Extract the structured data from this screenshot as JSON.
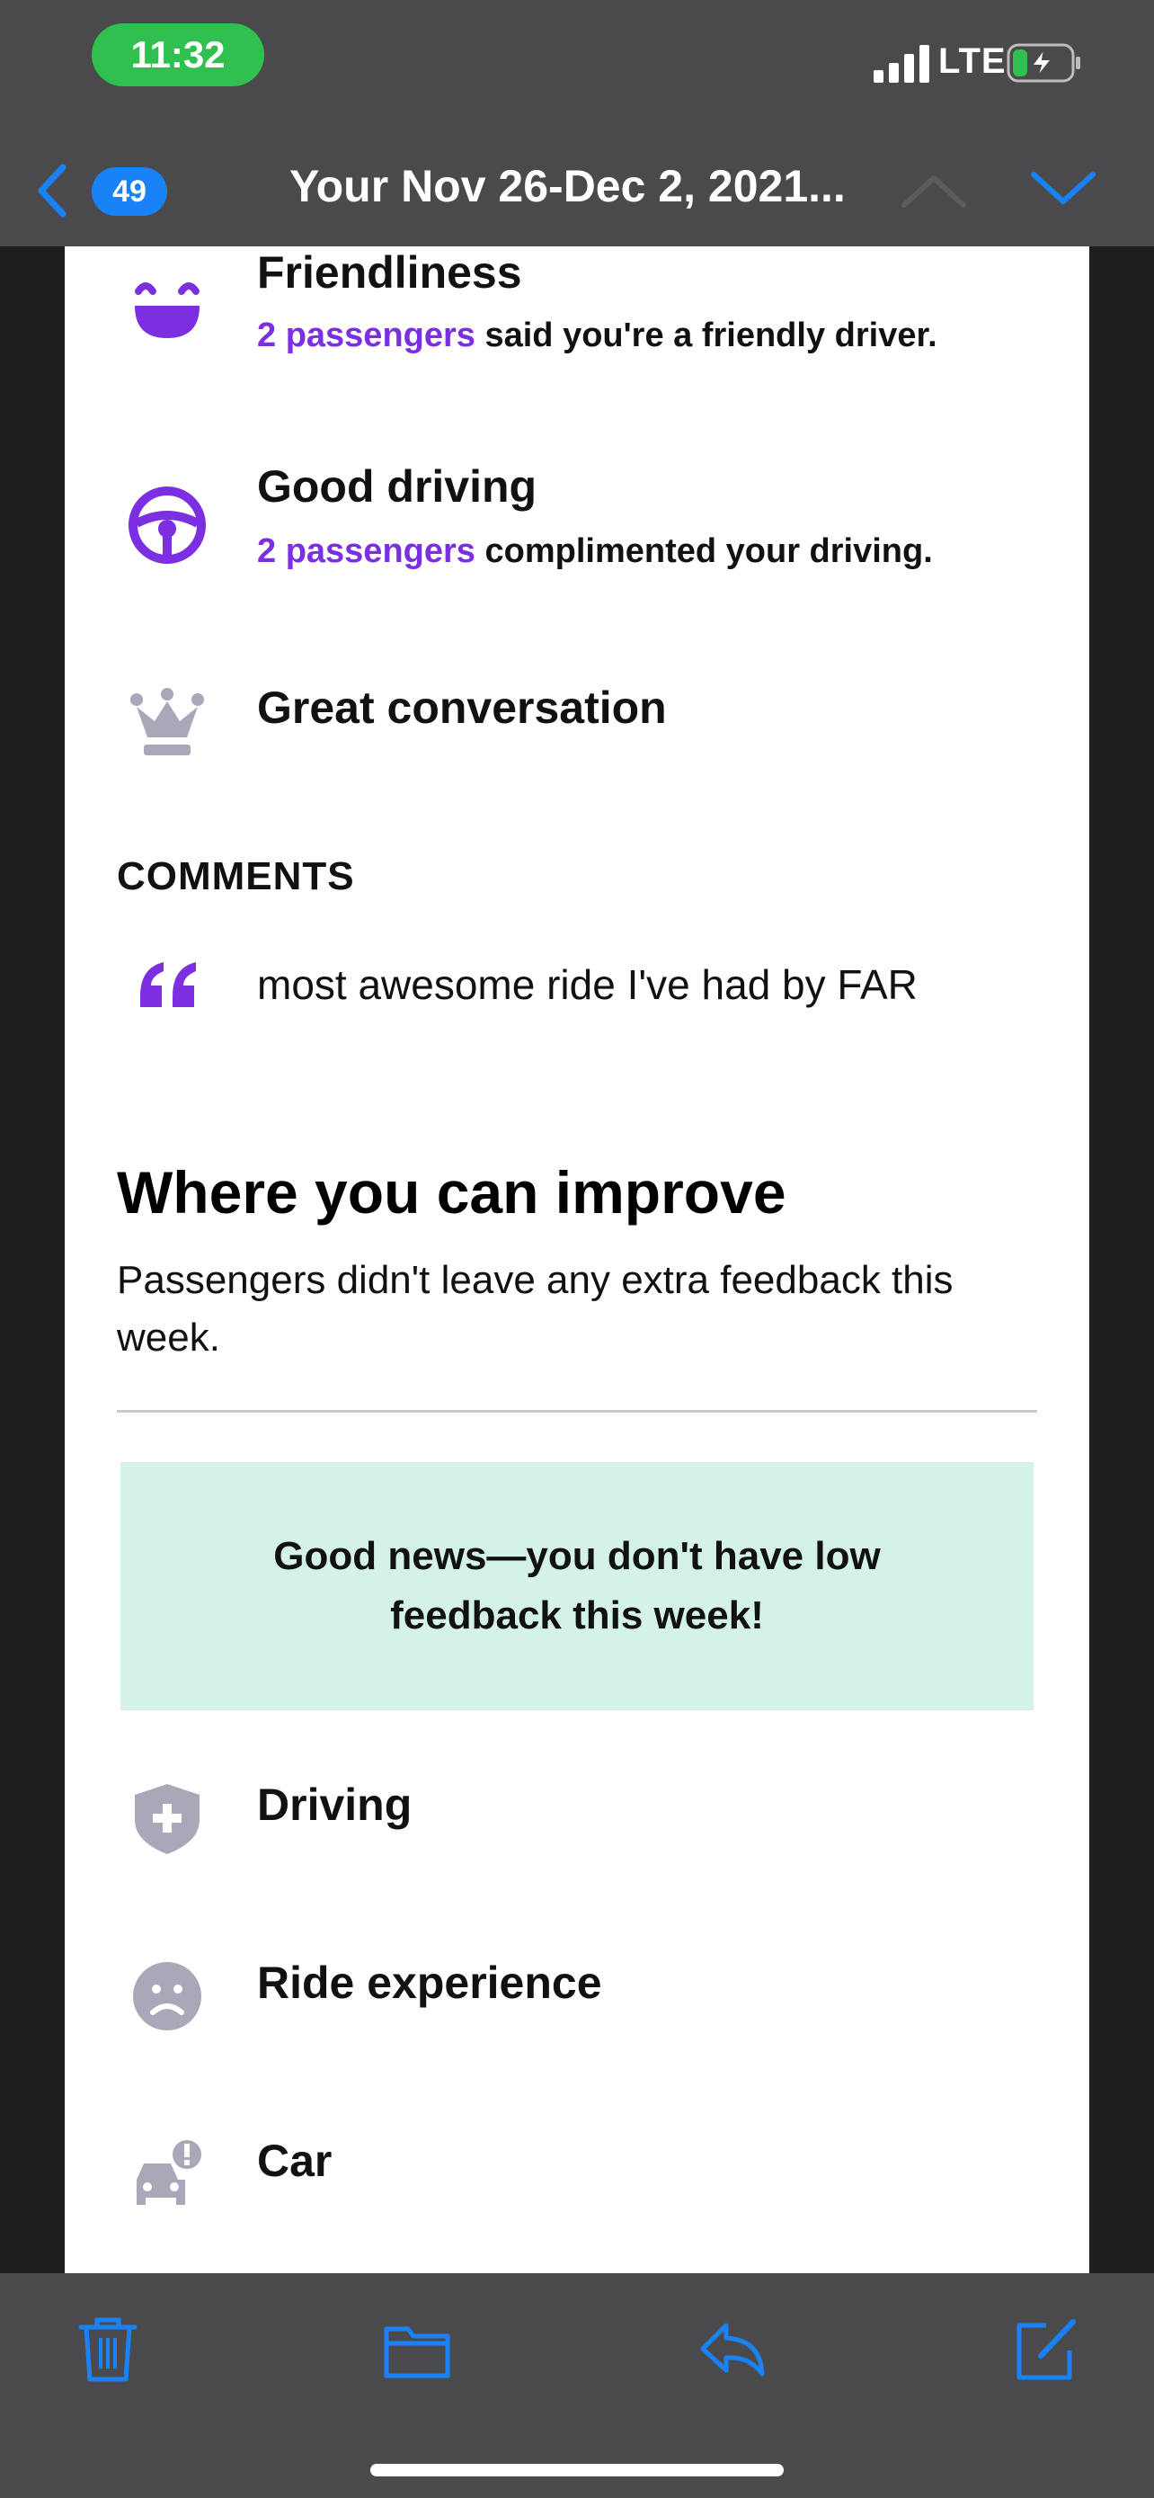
{
  "status_bar": {
    "time": "11:32",
    "network": "LTE",
    "time_pill_color": "#30c04f"
  },
  "nav": {
    "back_icon": "chevron-left-icon",
    "message_count": "49",
    "title": "Your Nov 26-Dec 2, 2021...",
    "up_icon": "chevron-up-icon",
    "down_icon": "chevron-down-icon",
    "accent_color": "#1a82f7"
  },
  "compliments": [
    {
      "icon": "smile-icon",
      "title": "Friendliness",
      "highlight": "2 passengers",
      "text": " said you're a friendly driver."
    },
    {
      "icon": "steering-wheel-icon",
      "title": "Good driving",
      "highlight": "2 passengers",
      "text": " complimented your driving."
    },
    {
      "icon": "crown-icon",
      "title": "Great conversation"
    }
  ],
  "comments": {
    "label": "COMMENTS",
    "items": [
      "most awesome ride I've had by FAR"
    ]
  },
  "improve": {
    "heading": "Where you can improve",
    "text": "Passengers didn't leave any extra feedback this week.",
    "good_news": "Good news—you don't have low feedback this week!",
    "good_news_bg": "#d4f1ea",
    "items": [
      {
        "icon": "shield-plus-icon",
        "label": "Driving"
      },
      {
        "icon": "sad-face-icon",
        "label": "Ride experience"
      },
      {
        "icon": "car-alert-icon",
        "label": "Car"
      }
    ]
  },
  "toolbar": {
    "items": [
      "trash-icon",
      "folder-icon",
      "reply-icon",
      "compose-icon"
    ]
  },
  "colors": {
    "purple": "#7b2fe0",
    "gray_icon": "#a9a8b8"
  }
}
